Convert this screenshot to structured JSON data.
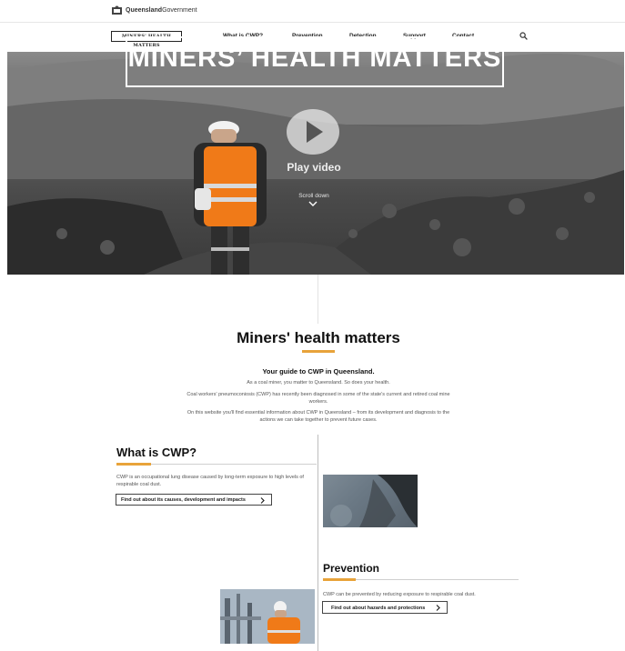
{
  "gov": {
    "name_bold": "Queensland",
    "name_light": "Government"
  },
  "nav": {
    "brand": "MINERS' HEALTH MATTERS",
    "items": [
      "What is CWP?",
      "Prevention",
      "Detection",
      "Support",
      "Contact"
    ]
  },
  "hero": {
    "title": "MINERS’ HEALTH MATTERS",
    "play_label": "Play video",
    "scroll_label": "Scroll down"
  },
  "intro": {
    "title": "Miners' health matters",
    "guide": "Your guide to CWP in Queensland.",
    "paragraphs": [
      "As a coal miner, you matter to Queensland. So does your health.",
      "Coal workers' pneumoconiosis (CWP) has recently been diagnosed in some of the state's current and retired coal mine workers.",
      "On this website you'll find essential information about CWP in Queensland – from its development and diagnosis to the actions we can take together to prevent future cases."
    ]
  },
  "cwp": {
    "title": "What is CWP?",
    "description": "CWP is an occupational lung disease caused by long-term exposure to high levels of respirable coal dust.",
    "button": "Find out about its causes, development and impacts"
  },
  "prevention": {
    "title": "Prevention",
    "description": "CWP can be prevented by reducing exposure to respirable coal dust.",
    "button": "Find out about hazards and protections"
  },
  "colors": {
    "accent": "#e8a33a",
    "vest": "#f07a18"
  }
}
